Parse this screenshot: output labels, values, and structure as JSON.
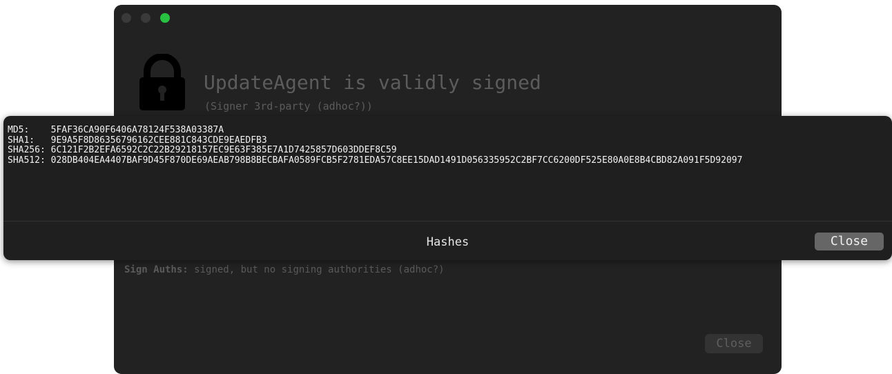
{
  "window": {
    "title": "UpdateAgent is validly signed",
    "subtitle": "(Signer 3rd-party (adhoc?))",
    "sign_auths_label": "Sign Auths:",
    "sign_auths_value": "signed, but no signing authorities (adhoc?)",
    "close_label": "Close",
    "lock_icon": "lock-icon",
    "traffic_lights": {
      "close_color": "#3a3a3a",
      "minimize_color": "#3a3a3a",
      "zoom_color": "#29c141"
    }
  },
  "sheet": {
    "title": "Hashes",
    "close_label": "Close",
    "hashes": [
      {
        "label": "MD5:   ",
        "value": "5FAF36CA90F6406A78124F538A03387A"
      },
      {
        "label": "SHA1:  ",
        "value": "9E9A5F8D86356796162CEE881C843CDE9EAEDFB3"
      },
      {
        "label": "SHA256:",
        "value": "6C121F2B2EFA6592C2C22B29218157EC9E63F385E7A1D7425857D603DDEF8C59"
      },
      {
        "label": "SHA512:",
        "value": "028DB404EA4407BAF9D45F870DE69AEAB798B8BECBAFA0589FCB5F2781EDA57C8EE15DAD1491D056335952C2BF7CC6200DF525E80A0E8B4CBD82A091F5D92097"
      }
    ]
  }
}
